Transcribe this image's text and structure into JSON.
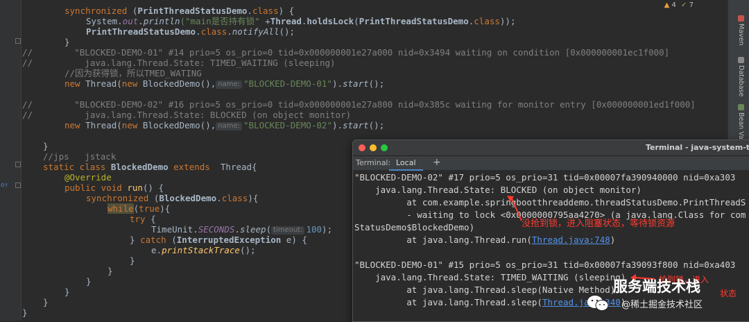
{
  "editor": {
    "inspections": {
      "warnings": "4",
      "weak": "7"
    },
    "lines": {
      "l1_kw": "synchronized",
      "l1_a": " (",
      "l1_cls": "PrintThreadStatusDemo",
      "l1_b": ".",
      "l1_class": "class",
      "l1_c": ") {",
      "l2_sys": "System.",
      "l2_out": "out",
      "l2_dot": ".",
      "l2_m": "println",
      "l2_str": "(\"main是否持有锁\"",
      "l2_rest1": " +",
      "l2_thread": "Thread",
      "l2_rest2": ".",
      "l2_hold": "holdsLock",
      "l2_rest3": "(",
      "l2_cls": "PrintThreadStatusDemo",
      "l2_rest4": ".",
      "l2_class": "class",
      "l2_rest5": "));",
      "l3_cls": "PrintThreadStatusDemo",
      "l3_dot": ".",
      "l3_class": "class",
      "l3_dot2": ".",
      "l3_m": "notifyAll",
      "l3_end": "();",
      "l4": "}",
      "l5": "//        \"BLOCKED-DEMO-01\" #14 prio=5 os_prio=0 tid=0x000000001e27a000 nid=0x3494 waiting on condition [0x000000001ec1f000]",
      "l6": "//          java.lang.Thread.State: TIMED_WAITING (sleeping)",
      "l7": "//因为获得锁，所以TMED_WATING",
      "l8_new": "new",
      "l8_a": " Thread(",
      "l8_new2": "new",
      "l8_b": " BlockedDemo(),",
      "l8_hint": "name:",
      "l8_str": "\"BLOCKED-DEMO-01\"",
      "l8_c": ").",
      "l8_m": "start",
      "l8_d": "();",
      "l9": "//        \"BLOCKED-DEMO-02\" #16 prio=5 os_prio=0 tid=0x000000001e27a800 nid=0x385c waiting for monitor entry [0x000000001ed1f000]",
      "l10": "//          java.lang.Thread.State: BLOCKED (on object monitor)",
      "l11_str": "\"BLOCKED-DEMO-02\"",
      "l12": "}",
      "l13": "//jps   jstack",
      "l14_kw1": "static class",
      "l14_cls": " BlockedDemo ",
      "l14_kw2": "extends",
      "l14_rest": "  Thread{",
      "l15": "@Override",
      "l16_kw": "public void",
      "l16_m": " run",
      "l16_rest": "() {",
      "l17_kw": "synchronized",
      "l17_a": " (",
      "l17_cls": "BlockedDemo",
      "l17_b": ".",
      "l17_class": "class",
      "l17_c": "){",
      "l18_kw": "while",
      "l18_a": "(",
      "l18_true": "true",
      "l18_b": "){",
      "l19_kw": "try",
      "l19_b": " {",
      "l20_a": "TimeUnit.",
      "l20_f": "SECONDS",
      "l20_b": ".",
      "l20_m": "sleep",
      "l20_c": "(",
      "l20_hint": "timeout:",
      "l20_num": "100",
      "l20_d": ");",
      "l21_a": "} ",
      "l21_kw": "catch",
      "l21_b": " (",
      "l21_cls": "InterruptedException",
      "l21_c": " e) {",
      "l22_a": "e.",
      "l22_m": "printStackTrace",
      "l22_b": "();",
      "close": "}"
    }
  },
  "right_toolbar": {
    "items": [
      "Maven",
      "Database",
      "Bean Validation"
    ]
  },
  "terminal": {
    "title": "Terminal - java-system-t",
    "tab_label": "Terminal:",
    "tab_local": "Local",
    "tab_add": "+",
    "lines": [
      "\"BLOCKED-DEMO-02\" #17 prio=5 os_prio=31 tid=0x00007fa390940000 nid=0xa303",
      "    java.lang.Thread.State: BLOCKED (on object monitor)",
      "          at com.example.springbootthreaddemo.threadStatusDemo.PrintThreadS",
      "          - waiting to lock <0x0000000795aa4270> (a java.lang.Class for com",
      "StatusDemo$BlockedDemo)",
      "          at java.lang.Thread.run(",
      "",
      "\"BLOCKED-DEMO-01\" #15 prio=5 os_prio=31 tid=0x00007fa39093f800 nid=0xa403",
      "    java.lang.Thread.State: TIMED_WAITING (sleeping)",
      "          at java.lang.Thread.sleep(Native Method)",
      "          at java.lang.Thread.sleep("
    ],
    "link1": "Thread.java:748",
    "link1_end": ")",
    "link2": "Thread.java:340",
    "link2_end": ")"
  },
  "annotations": {
    "blocked_note": "没抢到锁，进入阻塞状态，等待锁资源",
    "timed_note_a": "抢到锁，进入",
    "timed_note_b": "状态"
  },
  "watermark": {
    "brand": "服务端技术栈",
    "site": "@稀土掘金技术社区"
  },
  "colors": {
    "annotation": "#ff3b30",
    "link": "#5394ec",
    "keyword": "#cc7832",
    "string": "#6a8759"
  }
}
